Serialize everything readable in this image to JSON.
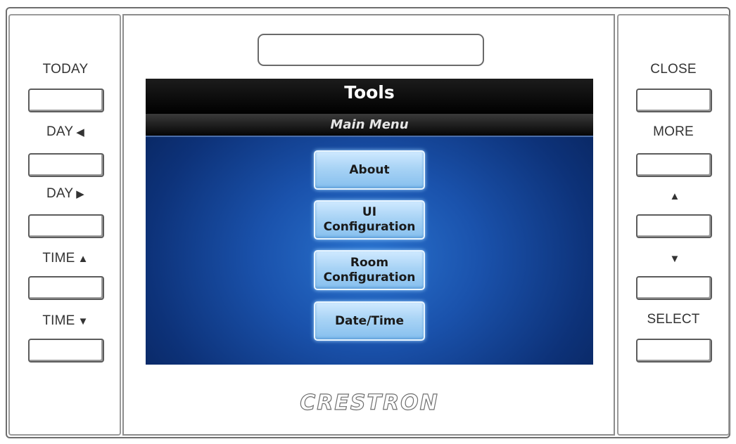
{
  "left_buttons": [
    {
      "label": "TODAY",
      "glyph": ""
    },
    {
      "label": "DAY",
      "glyph": "◀"
    },
    {
      "label": "DAY",
      "glyph": "▶"
    },
    {
      "label": "TIME",
      "glyph": "▲"
    },
    {
      "label": "TIME",
      "glyph": "▼"
    }
  ],
  "right_buttons": [
    {
      "label": "CLOSE",
      "glyph": ""
    },
    {
      "label": "MORE",
      "glyph": ""
    },
    {
      "label": "",
      "glyph": "▲"
    },
    {
      "label": "",
      "glyph": "▼"
    },
    {
      "label": "SELECT",
      "glyph": ""
    }
  ],
  "screen": {
    "title": "Tools",
    "subtitle": "Main Menu",
    "menu": [
      "About",
      "UI\nConfiguration",
      "Room\nConfiguration",
      "Date/Time"
    ]
  },
  "brand": "CRESTRON",
  "colors": {
    "screen_bg": "#1a52ac",
    "menu_button": "#a8d3f5",
    "header": "#000000"
  }
}
